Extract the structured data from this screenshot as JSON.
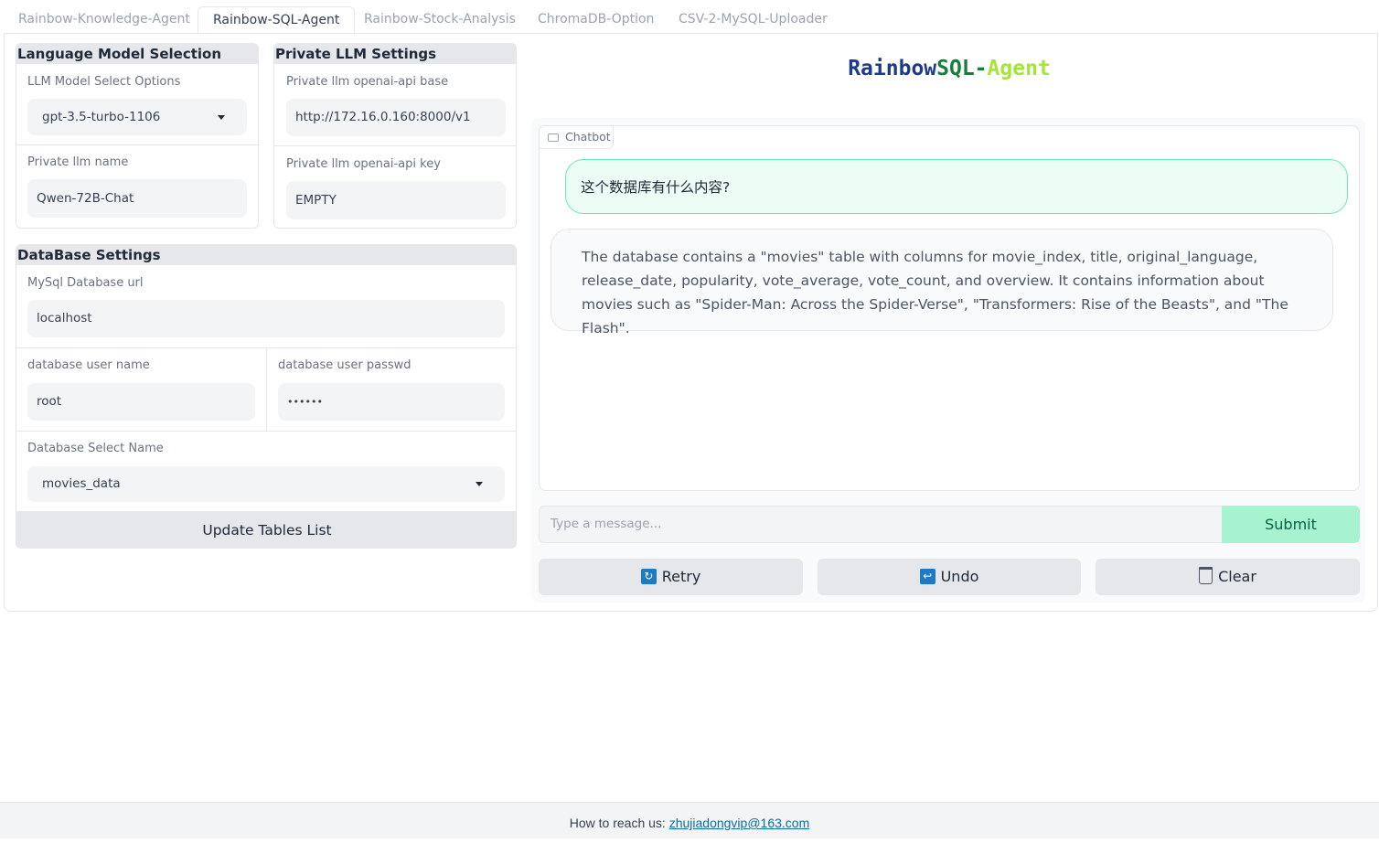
{
  "tabs": [
    {
      "label": "Rainbow-Knowledge-Agent",
      "active": false
    },
    {
      "label": "Rainbow-SQL-Agent",
      "active": true
    },
    {
      "label": "Rainbow-Stock-Analysis",
      "active": false
    },
    {
      "label": "ChromaDB-Option",
      "active": false
    },
    {
      "label": "CSV-2-MySQL-Uploader",
      "active": false
    }
  ],
  "lm_selection": {
    "title": "Language Model Selection",
    "model_label": "LLM Model Select Options",
    "model_value": "gpt-3.5-turbo-1106",
    "private_name_label": "Private llm name",
    "private_name_value": "Qwen-72B-Chat"
  },
  "private_llm": {
    "title": "Private LLM Settings",
    "api_base_label": "Private llm openai-api base",
    "api_base_value": "http://172.16.0.160:8000/v1",
    "api_key_label": "Private llm openai-api key",
    "api_key_value": "EMPTY"
  },
  "database": {
    "title": "DataBase Settings",
    "url_label": "MySql Database url",
    "url_value": "localhost",
    "user_label": "database user name",
    "user_value": "root",
    "passwd_label": "database user passwd",
    "passwd_value": "••••••",
    "db_name_label": "Database Select Name",
    "db_name_value": "movies_data",
    "update_button": "Update Tables List"
  },
  "app_title": {
    "part1": "Rainbow",
    "part2": "SQL-",
    "part3": "Agent",
    "colors": [
      "#1e3a8a",
      "#15803d",
      "#a3e635"
    ]
  },
  "chat": {
    "label": "Chatbot",
    "user_message": "这个数据库有什么内容?",
    "bot_message": "The database contains a \"movies\" table with columns for movie_index, title, original_language, release_date, popularity, vote_average, vote_count, and overview. It contains information about movies such as \"Spider-Man: Across the Spider-Verse\", \"Transformers: Rise of the Beasts\", and \"The Flash\".",
    "input_placeholder": "Type a message...",
    "submit": "Submit",
    "retry": "Retry",
    "undo": "Undo",
    "clear": "Clear"
  },
  "footer": {
    "prefix": "How to reach us: ",
    "email": "zhujiadongvip@163.com"
  }
}
